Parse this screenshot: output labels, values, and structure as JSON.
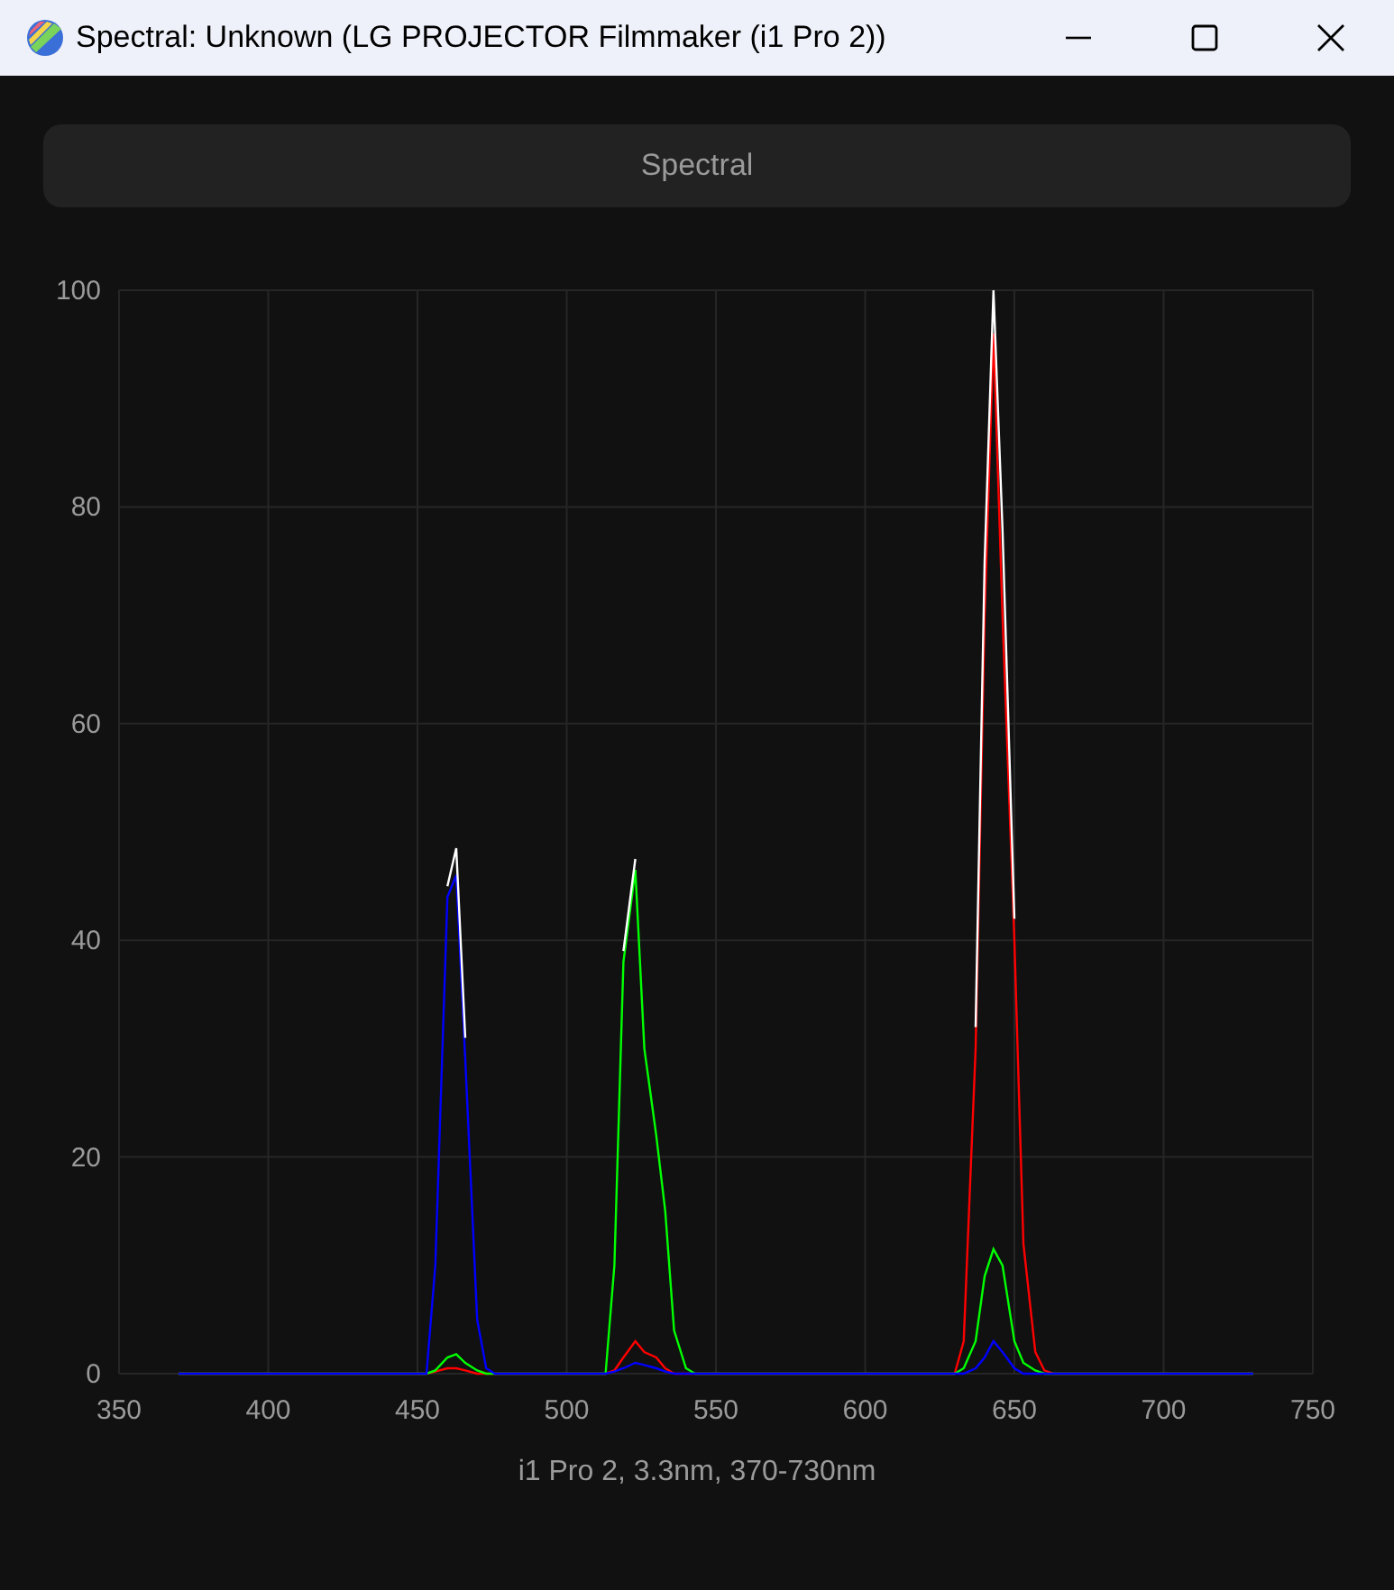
{
  "window": {
    "title": "Spectral: Unknown (LG PROJECTOR Filmmaker (i1 Pro 2))"
  },
  "header_button": {
    "label": "Spectral"
  },
  "chart": {
    "chart_data": {
      "type": "line",
      "x": [
        370,
        450,
        453,
        456,
        460,
        463,
        466,
        470,
        473,
        476,
        510,
        513,
        516,
        519,
        523,
        526,
        530,
        533,
        536,
        540,
        543,
        627,
        630,
        633,
        637,
        640,
        643,
        646,
        650,
        653,
        657,
        660,
        663,
        730
      ],
      "series": [
        {
          "color": "#ff0000",
          "values": [
            0,
            0,
            0,
            0.2,
            0.5,
            0.5,
            0.3,
            0,
            0,
            0,
            0,
            0,
            0.3,
            1.5,
            3,
            2,
            1.5,
            0.5,
            0,
            0,
            0,
            0,
            0,
            3,
            30,
            70,
            96,
            70,
            40,
            12,
            2,
            0.3,
            0,
            0
          ]
        },
        {
          "color": "#00ff00",
          "values": [
            0,
            0,
            0,
            0.3,
            1.5,
            1.8,
            1,
            0.3,
            0,
            0,
            0,
            0,
            10,
            38,
            46.5,
            30,
            22,
            15,
            4,
            0.5,
            0,
            0,
            0,
            0.5,
            3,
            9,
            11.5,
            10,
            3,
            1,
            0.3,
            0,
            0,
            0
          ]
        },
        {
          "color": "#0000ff",
          "values": [
            0,
            0,
            0,
            10,
            44,
            46,
            29,
            5,
            0.5,
            0,
            0,
            0,
            0.2,
            0.5,
            1,
            0.8,
            0.5,
            0.2,
            0,
            0,
            0,
            0,
            0,
            0,
            0.5,
            1.5,
            3,
            2,
            0.5,
            0,
            0,
            0,
            0,
            0
          ]
        },
        {
          "color": "#ffffff",
          "values": [
            null,
            null,
            null,
            null,
            45,
            48.5,
            31,
            null,
            null,
            null,
            null,
            null,
            null,
            39,
            47.5,
            null,
            null,
            null,
            null,
            null,
            null,
            null,
            null,
            null,
            32,
            75,
            100,
            78,
            42,
            null,
            null,
            null,
            null,
            null
          ]
        }
      ],
      "grid": true,
      "xlim": [
        350,
        750
      ],
      "ylim": [
        0,
        100
      ],
      "xticks": [
        350,
        400,
        450,
        500,
        550,
        600,
        650,
        700,
        750
      ],
      "yticks": [
        0,
        20,
        40,
        60,
        80,
        100
      ]
    },
    "caption": "i1 Pro 2, 3.3nm, 370-730nm"
  }
}
